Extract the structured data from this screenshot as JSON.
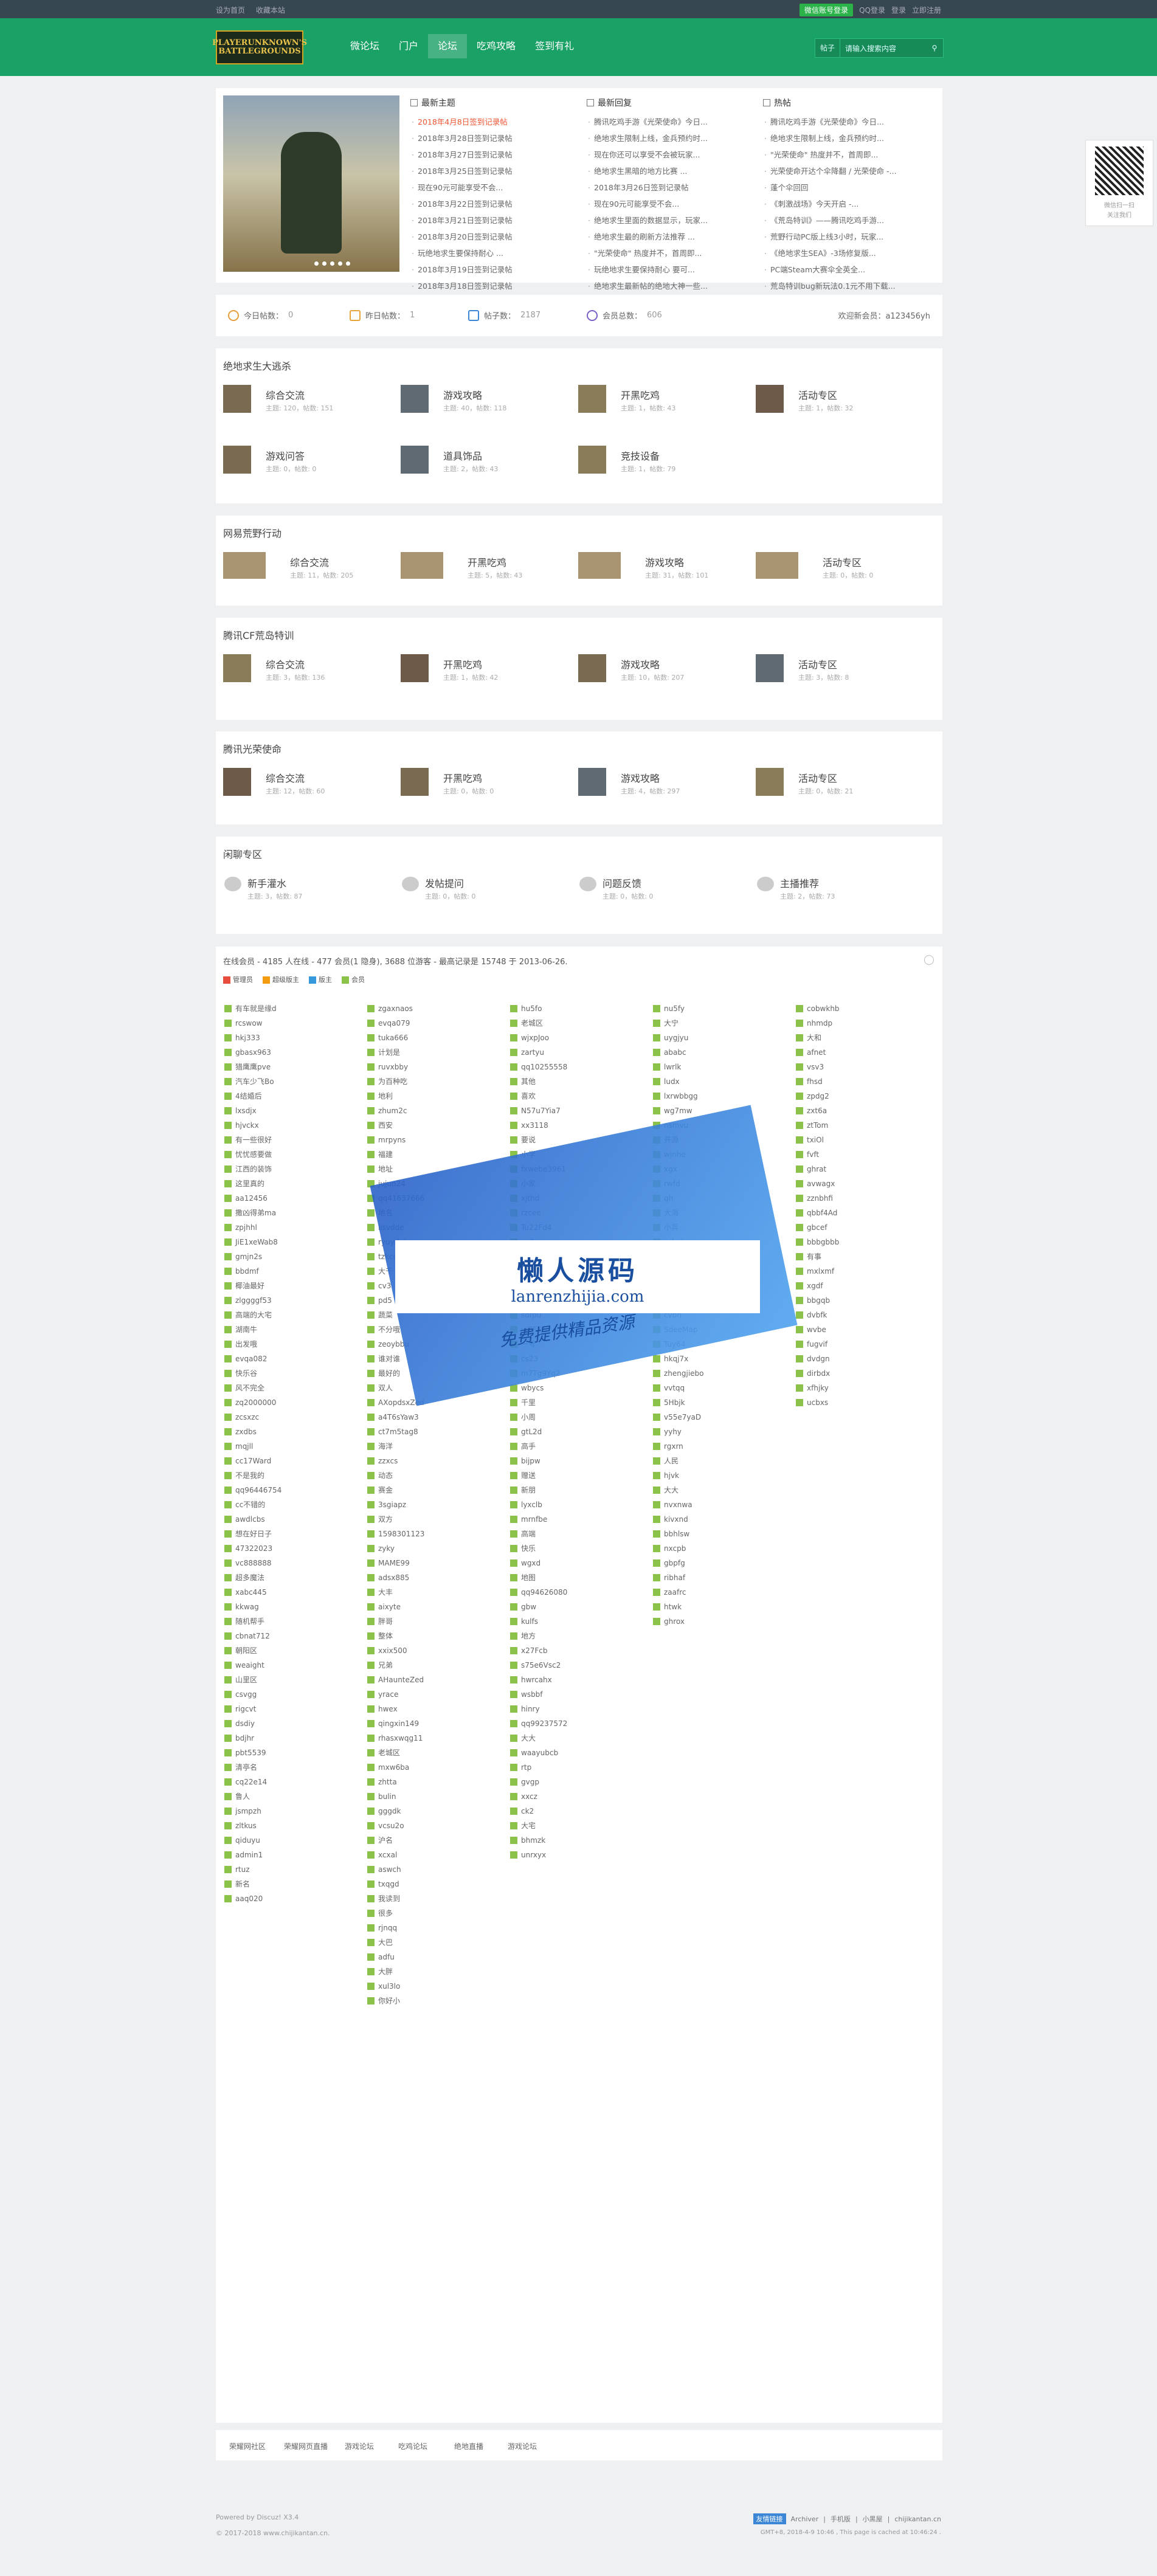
{
  "topbar": {
    "set_home": "设为首页",
    "bookmark": "收藏本站",
    "wechat_login": "微信账号登录",
    "qq_login": "QQ登录",
    "login": "登录",
    "register": "立即注册"
  },
  "logo_text": "PLAYERUNKNOWN'S BATTLEGROUNDS",
  "nav": [
    "微论坛",
    "门户",
    "论坛",
    "吃鸡攻略",
    "签到有礼"
  ],
  "search": {
    "select": "帖子",
    "placeholder": "请输入搜索内容"
  },
  "hero": {
    "newest": {
      "title": "最新主题",
      "items": [
        "2018年4月8日签到记录帖",
        "2018年3月28日签到记录帖",
        "2018年3月27日签到记录帖",
        "2018年3月25日签到记录帖",
        "现在90元可能享受不会...",
        "2018年3月22日签到记录帖",
        "2018年3月21日签到记录帖",
        "2018年3月20日签到记录帖",
        "玩绝地求生要保持耐心 ...",
        "2018年3月19日签到记录帖",
        "2018年3月18日签到记录帖"
      ]
    },
    "latest_reply": {
      "title": "最新回复",
      "items": [
        "腾讯吃鸡手游《光荣使命》今日...",
        "绝地求生限制上线，金兵预约时...",
        "现在你还可以享受不会被玩家...",
        "绝地求生黑暗的地方比赛 ...",
        "2018年3月26日签到记录帖",
        "现在90元可能享受不会...",
        "绝地求生里面的数据显示，玩家...",
        "绝地求生最的刷新方法推荐 ...",
        "\"光荣使命\" 热度并不，首周即...",
        "玩绝地求生要保持耐心 要可...",
        "绝地求生最新帖的绝地大神一些..."
      ]
    },
    "hot": {
      "title": "热帖",
      "items": [
        "腾讯吃鸡手游《光荣使命》今日...",
        "绝地求生限制上线，金兵预约时...",
        "\"光荣使命\" 热度并不，首周即...",
        "光荣使命开达个伞降翻 / 光荣使命 -...",
        "蓬个伞回回",
        "《刺激战场》今天开启 -...",
        "《荒岛特训》——腾讯吃鸡手游...",
        "荒野行动PC版上线3小时，玩家...",
        "《绝地求生SEA》-3场修复版...",
        "PC端Steam大赛伞全英全...",
        "荒岛特训bug新玩法0.1元不用下载..."
      ]
    }
  },
  "stats": {
    "today_label": "今日帖数：",
    "today": "0",
    "yesterday_label": "昨日帖数：",
    "yesterday": "1",
    "posts_label": "帖子数：",
    "posts": "2187",
    "members_label": "会员总数：",
    "members": "606",
    "welcome": "欢迎新会员：a123456yh"
  },
  "sections": [
    {
      "title": "绝地求生大逃杀",
      "forums": [
        {
          "name": "综合交流",
          "meta": "主题: 120，帖数: 151"
        },
        {
          "name": "游戏攻略",
          "meta": "主题: 40，帖数: 118"
        },
        {
          "name": "开黑吃鸡",
          "meta": "主题: 1，帖数: 43"
        },
        {
          "name": "活动专区",
          "meta": "主题: 1，帖数: 32"
        },
        {
          "name": "游戏问答",
          "meta": "主题: 0，帖数: 0"
        },
        {
          "name": "道具饰品",
          "meta": "主题: 2，帖数: 43"
        },
        {
          "name": "竞技设备",
          "meta": "主题: 1，帖数: 79"
        }
      ]
    },
    {
      "title": "网易荒野行动",
      "forums": [
        {
          "name": "综合交流",
          "meta": "主题: 11，帖数: 205"
        },
        {
          "name": "开黑吃鸡",
          "meta": "主题: 5，帖数: 43"
        },
        {
          "name": "游戏攻略",
          "meta": "主题: 31，帖数: 101"
        },
        {
          "name": "活动专区",
          "meta": "主题: 0，帖数: 0"
        }
      ]
    },
    {
      "title": "腾讯CF荒岛特训",
      "forums": [
        {
          "name": "综合交流",
          "meta": "主题: 3，帖数: 136"
        },
        {
          "name": "开黑吃鸡",
          "meta": "主题: 1，帖数: 42"
        },
        {
          "name": "游戏攻略",
          "meta": "主题: 10，帖数: 207"
        },
        {
          "name": "活动专区",
          "meta": "主题: 3，帖数: 8"
        }
      ]
    },
    {
      "title": "腾讯光荣使命",
      "forums": [
        {
          "name": "综合交流",
          "meta": "主题: 12，帖数: 60"
        },
        {
          "name": "开黑吃鸡",
          "meta": "主题: 0，帖数: 0"
        },
        {
          "name": "游戏攻略",
          "meta": "主题: 4，帖数: 297"
        },
        {
          "name": "活动专区",
          "meta": "主题: 0，帖数: 21"
        }
      ]
    },
    {
      "title": "闲聊专区",
      "forums": [
        {
          "name": "新手灌水",
          "meta": "主题: 3，帖数: 87"
        },
        {
          "name": "发帖提问",
          "meta": "主题: 0，帖数: 0"
        },
        {
          "name": "问题反馈",
          "meta": "主题: 0，帖数: 0"
        },
        {
          "name": "主播推荐",
          "meta": "主题: 2，帖数: 73"
        }
      ]
    }
  ],
  "online": {
    "header": "在线会员 - 4185 人在线 - 477 会员(1 隐身), 3688 位游客 - 最高记录是 15748 于 2013-06-26.",
    "legend": [
      "管理员",
      "超级版主",
      "版主",
      "会员"
    ],
    "legend_colors": [
      "#e74c3c",
      "#f39c12",
      "#3498db",
      "#8bc34a"
    ],
    "columns": [
      [
        "有车就是缘d",
        "rcswow",
        "hkj333",
        "gbasx963",
        "猎鹰鹰pve",
        "汽车少飞Bo",
        "4结婚后",
        "lxsdjx",
        "hjvckx",
        "有一些很好",
        "忧忧感要做",
        "江西的装饰",
        "这里真的",
        "aa12456",
        "撒凶得弟ma",
        "zpjhhl",
        "JiE1xeWab8",
        "gmjn2s",
        "bbdmf",
        "椰油最好",
        "zlggggf53",
        "高端的大宅",
        "湖南牛",
        "出发哦",
        "evqa082",
        "快乐谷",
        "风不完全",
        "zq2000000",
        "zcsxzc",
        "zxdbs",
        "mqjll",
        "cc17Ward",
        "不是我的",
        "qq96446754",
        "cc不错的",
        "awdlcbs",
        "想在好日子",
        "47322023",
        "vc888888",
        "超多魔法",
        "xabc445",
        "kkwag",
        "随机帮手",
        "cbnat712",
        "朝阳区",
        "weaight",
        "山里区",
        "csvgg",
        "rigcvt",
        "dsdiy",
        "bdjhr",
        "pbt5539",
        "清亭名",
        "cq22e14",
        "鲁人",
        "jsmpzh",
        "zltkus",
        "qiduyu",
        "admin1",
        "rtuz",
        "新名",
        "aaq020"
      ]
    ],
    "col2": [
      "zgaxnaos",
      "evqa079",
      "tuka666",
      "计划是",
      "ruvxbby",
      "为百种吃",
      "地利",
      "zhum2c",
      "西安",
      "mrpyns",
      "福建",
      "地址",
      "jujun24",
      "qq41637666",
      "地名",
      "lisvdde",
      "ryuydgh",
      "tzkcuvde",
      "大千",
      "cv3",
      "pd5",
      "蔬菜",
      "不分哦",
      "zeoybbu",
      "谁对谁",
      "最好的",
      "双人",
      "AXopdsxZed",
      "a4T6sYaw3",
      "ct7m5tag8",
      "海洋",
      "zzxcs",
      "动态",
      "赛金",
      "3sgiapz",
      "双方",
      "1598301123",
      "zyky",
      "MAME99",
      "adsx885",
      "大丰",
      "aixyte",
      "胖哥",
      "整体",
      "xxix500",
      "兄弟",
      "AHaunteZed",
      "yrace",
      "hwex",
      "qingxin149",
      "rhasxwqg11",
      "老城区",
      "mxw6ba",
      "zhtta",
      "bulin",
      "gggdk",
      "vcsu2o",
      "沪名",
      "xcxal",
      "aswch",
      "txqgd",
      "我读到",
      "很多",
      "rjnqq",
      "大巴",
      "adfu",
      "大胖",
      "xul3lo",
      "你好小"
    ],
    "col3": [
      "hu5fo",
      "老城区",
      "wjxpJoo",
      "zartyu",
      "qq10255558",
      "其他",
      "喜欢",
      "N57u7Yia7",
      "xx3118",
      "要说",
      "小学",
      "fxwebe3961",
      "小家",
      "xjthd",
      "rzcee",
      "Tu22Fd4",
      "ca3",
      "ygqpo",
      "bxed11",
      "小明",
      "jx3",
      "sdfpu",
      "jq7FXw",
      "一号",
      "cs23",
      "m7Tg9Yq2",
      "wbycs",
      "千里",
      "小周",
      "gtL2d",
      "高手",
      "bijpw",
      "赠送",
      "新朋",
      "lyxclb",
      "mrnfbe",
      "高端",
      "快乐",
      "wgxd",
      "地图",
      "qq94626080",
      "gbw",
      "kulfs",
      "地方",
      "x27Fcb",
      "s75e6Vsc2",
      "hwrcahx",
      "wsbbf",
      "hinry",
      "qq99237572",
      "大大",
      "waayubcb",
      "rtp",
      "gvgp",
      "xxcz",
      "ck2",
      "大宅",
      "bhmzk",
      "unrxyx"
    ],
    "col4": [
      "nu5fy",
      "大宁",
      "uygjyu",
      "ababc",
      "lwrlk",
      "ludx",
      "lxrwbbgg",
      "wg7mw",
      "nsmvu",
      "开源",
      "wjnhe",
      "xgx",
      "rwfd",
      "qh",
      "大海",
      "小兵",
      "wiheb",
      "vqsbq",
      "大米",
      "tu",
      "hj104",
      "cvbh",
      "SdeeMap",
      "Tuy64",
      "hkqj7x",
      "zhengjiebo",
      "vvtqq",
      "5Hbjk",
      "v55e7yaD",
      "yyhy",
      "rgxrn",
      "人民",
      "hjvk",
      "大大",
      "nvxnwa",
      "kivxnd",
      "bbhlsw",
      "nxcpb",
      "gbpfg",
      "ribhaf",
      "zaafrc",
      "htwk",
      "ghrox"
    ],
    "col5": [
      "cobwkhb",
      "nhmdp",
      "大和",
      "afnet",
      "vsv3",
      "fhsd",
      "zpdg2",
      "zxt6a",
      "ztTom",
      "txiOl",
      "fvft",
      "ghrat",
      "avwagx",
      "zznbhfi",
      "qbbf4Ad",
      "gbcef",
      "bbbgbbb",
      "有事",
      "mxlxmf",
      "xgdf",
      "bbgqb",
      "dvbfk",
      "wvbe",
      "fugvif",
      "dvdgn",
      "dirbdx",
      "xfhjky",
      "ucbxs"
    ]
  },
  "watermark": {
    "title": "懒人源码",
    "url": "lanrenzhijia.com",
    "slogan": "免费提供精品资源"
  },
  "links": [
    "荣耀网社区",
    "荣耀网页直播",
    "游戏论坛",
    "吃鸡论坛",
    "绝地直播",
    "游戏论坛"
  ],
  "footer": {
    "powered": "Powered by Discuz! X3.4",
    "copyright": "© 2017-2018 www.chijikantan.cn.",
    "archiver": "Archiver",
    "mobile": "手机版",
    "dark": "小黑屋",
    "site": "chijikantan.cn",
    "badge": "友情链接",
    "gmt": "GMT+8, 2018-4-9 10:46 , This page is cached at 10:46:24 ."
  },
  "qr": {
    "line1": "微信扫一扫",
    "line2": "关注我们"
  }
}
